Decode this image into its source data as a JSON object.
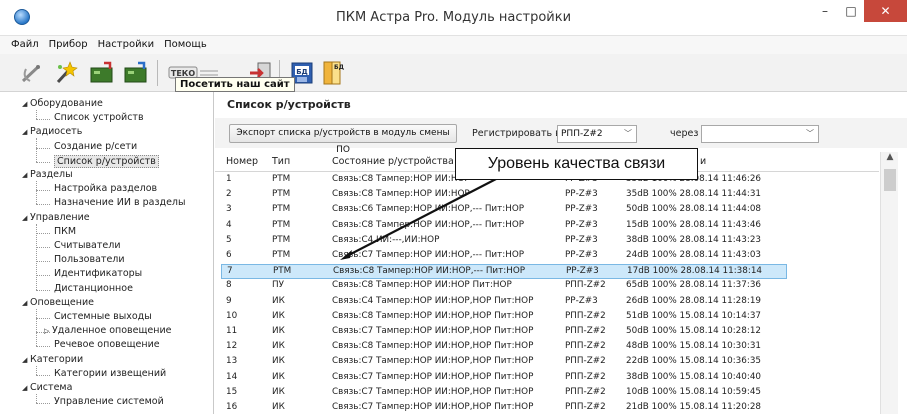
{
  "window": {
    "title": "ПКМ Астра Pro. Модуль настройки",
    "min_glyph": "–",
    "max_glyph": "□",
    "close_glyph": "✕"
  },
  "menu": [
    "Файл",
    "Прибор",
    "Настройки",
    "Помощь"
  ],
  "toolbar": {
    "tooltip": "Посетить наш сайт",
    "icons": [
      "satellite-icon",
      "magic-wand-icon",
      "device-read-icon",
      "device-write-icon",
      "teko-logo-icon",
      "exit-icon",
      "database-icon",
      "database-export-icon"
    ]
  },
  "tree": [
    {
      "label": "Оборудование",
      "level": 0
    },
    {
      "label": "Список устройств",
      "level": 1
    },
    {
      "label": "Радиосеть",
      "level": 0
    },
    {
      "label": "Создание р/сети",
      "level": 1
    },
    {
      "label": "Список р/устройств",
      "level": 1,
      "selected": true
    },
    {
      "label": "Разделы",
      "level": 0
    },
    {
      "label": "Настройка разделов",
      "level": 1
    },
    {
      "label": "Назначение ИИ в разделы",
      "level": 1
    },
    {
      "label": "Управление",
      "level": 0
    },
    {
      "label": "ПКМ",
      "level": 1
    },
    {
      "label": "Считыватели",
      "level": 1
    },
    {
      "label": "Пользователи",
      "level": 1
    },
    {
      "label": "Идентификаторы",
      "level": 1
    },
    {
      "label": "Дистанционное",
      "level": 1
    },
    {
      "label": "Оповещение",
      "level": 0
    },
    {
      "label": "Системные выходы",
      "level": 1
    },
    {
      "label": "Удаленное оповещение",
      "level": 1,
      "collapsed": true
    },
    {
      "label": "Речевое оповещение",
      "level": 1
    },
    {
      "label": "Категории",
      "level": 0
    },
    {
      "label": "Категории извещений",
      "level": 1
    },
    {
      "label": "Система",
      "level": 0
    },
    {
      "label": "Управление системой",
      "level": 1
    }
  ],
  "panel": {
    "title": "Список р/устройств",
    "export_button": "Экспорт списка р/устройств в модуль смены ПО",
    "register_label": "Регистрировать в",
    "register_value": "РПП-Z#2",
    "via_label": "через",
    "via_value": ""
  },
  "table": {
    "headers": [
      "Номер",
      "Тип",
      "Состояние р/устройства",
      "",
      "и"
    ],
    "rows": [
      [
        "1",
        "РТМ",
        "Связь:С8 Тампер:НОР ИИ:НОР",
        "РР-Z#3",
        "35dB 100% 28.08.14 11:46:26"
      ],
      [
        "2",
        "РТМ",
        "Связь:С8 Тампер:НОР ИИ:НОР",
        "РР-Z#3",
        "35dB 100% 28.08.14 11:44:31"
      ],
      [
        "3",
        "РТМ",
        "Связь:С6 Тампер:НОР ИИ:НОР,--- Пит:НОР",
        "РР-Z#3",
        "50dB 100% 28.08.14 11:44:08"
      ],
      [
        "4",
        "РТМ",
        "Связь:С8 Тампер:НОР ИИ:НОР,--- Пит:НОР",
        "РР-Z#3",
        "15dB 100% 28.08.14 11:43:46"
      ],
      [
        "5",
        "РТМ",
        "Связь:С4 ИИ:---,ИИ:НОР",
        "РР-Z#3",
        "38dB 100% 28.08.14 11:43:23"
      ],
      [
        "6",
        "РТМ",
        "Связь:С7 Тампер:НОР ИИ:НОР,--- Пит:НОР",
        "РР-Z#3",
        "24dB 100% 28.08.14 11:43:03"
      ],
      [
        "7",
        "РТМ",
        "Связь:С8 Тампер:НОР ИИ:НОР,--- Пит:НОР",
        "РР-Z#3",
        "17dB 100% 28.08.14 11:38:14"
      ],
      [
        "8",
        "ПУ",
        "Связь:С8 Тампер:НОР ИИ:НОР Пит:НОР",
        "РПП-Z#2",
        "65dB 100% 28.08.14 11:37:36"
      ],
      [
        "9",
        "ИК",
        "Связь:С4 Тампер:НОР ИИ:НОР,НОР Пит:НОР",
        "РР-Z#3",
        "26dB 100% 28.08.14 11:28:19"
      ],
      [
        "10",
        "ИК",
        "Связь:С8 Тампер:НОР ИИ:НОР,НОР Пит:НОР",
        "РПП-Z#2",
        "51dB 100% 15.08.14 10:14:37"
      ],
      [
        "11",
        "ИК",
        "Связь:С7 Тампер:НОР ИИ:НОР,НОР Пит:НОР",
        "РПП-Z#2",
        "50dB 100% 15.08.14 10:28:12"
      ],
      [
        "12",
        "ИК",
        "Связь:С8 Тампер:НОР ИИ:НОР,НОР Пит:НОР",
        "РПП-Z#2",
        "48dB 100% 15.08.14 10:30:31"
      ],
      [
        "13",
        "ИК",
        "Связь:С7 Тампер:НОР ИИ:НОР,НОР Пит:НОР",
        "РПП-Z#2",
        "22dB 100% 15.08.14 10:36:35"
      ],
      [
        "14",
        "ИК",
        "Связь:С7 Тампер:НОР ИИ:НОР,НОР Пит:НОР",
        "РПП-Z#2",
        "38dB 100% 15.08.14 10:40:40"
      ],
      [
        "15",
        "ИК",
        "Связь:С7 Тампер:НОР ИИ:НОР,НОР Пит:НОР",
        "РПП-Z#2",
        "10dB 100% 15.08.14 10:59:45"
      ],
      [
        "16",
        "ИК",
        "Связь:С7 Тампер:НОР ИИ:НОР,НОР Пит:НОР",
        "РПП-Z#2",
        "21dB 100% 15.08.14 11:20:28"
      ]
    ],
    "selected_row": 7
  },
  "callout": "Уровень качества связи",
  "colors": {
    "selection": "#cde8fa",
    "close_button": "#c7483b",
    "tooltip_bg": "#fffff0"
  }
}
